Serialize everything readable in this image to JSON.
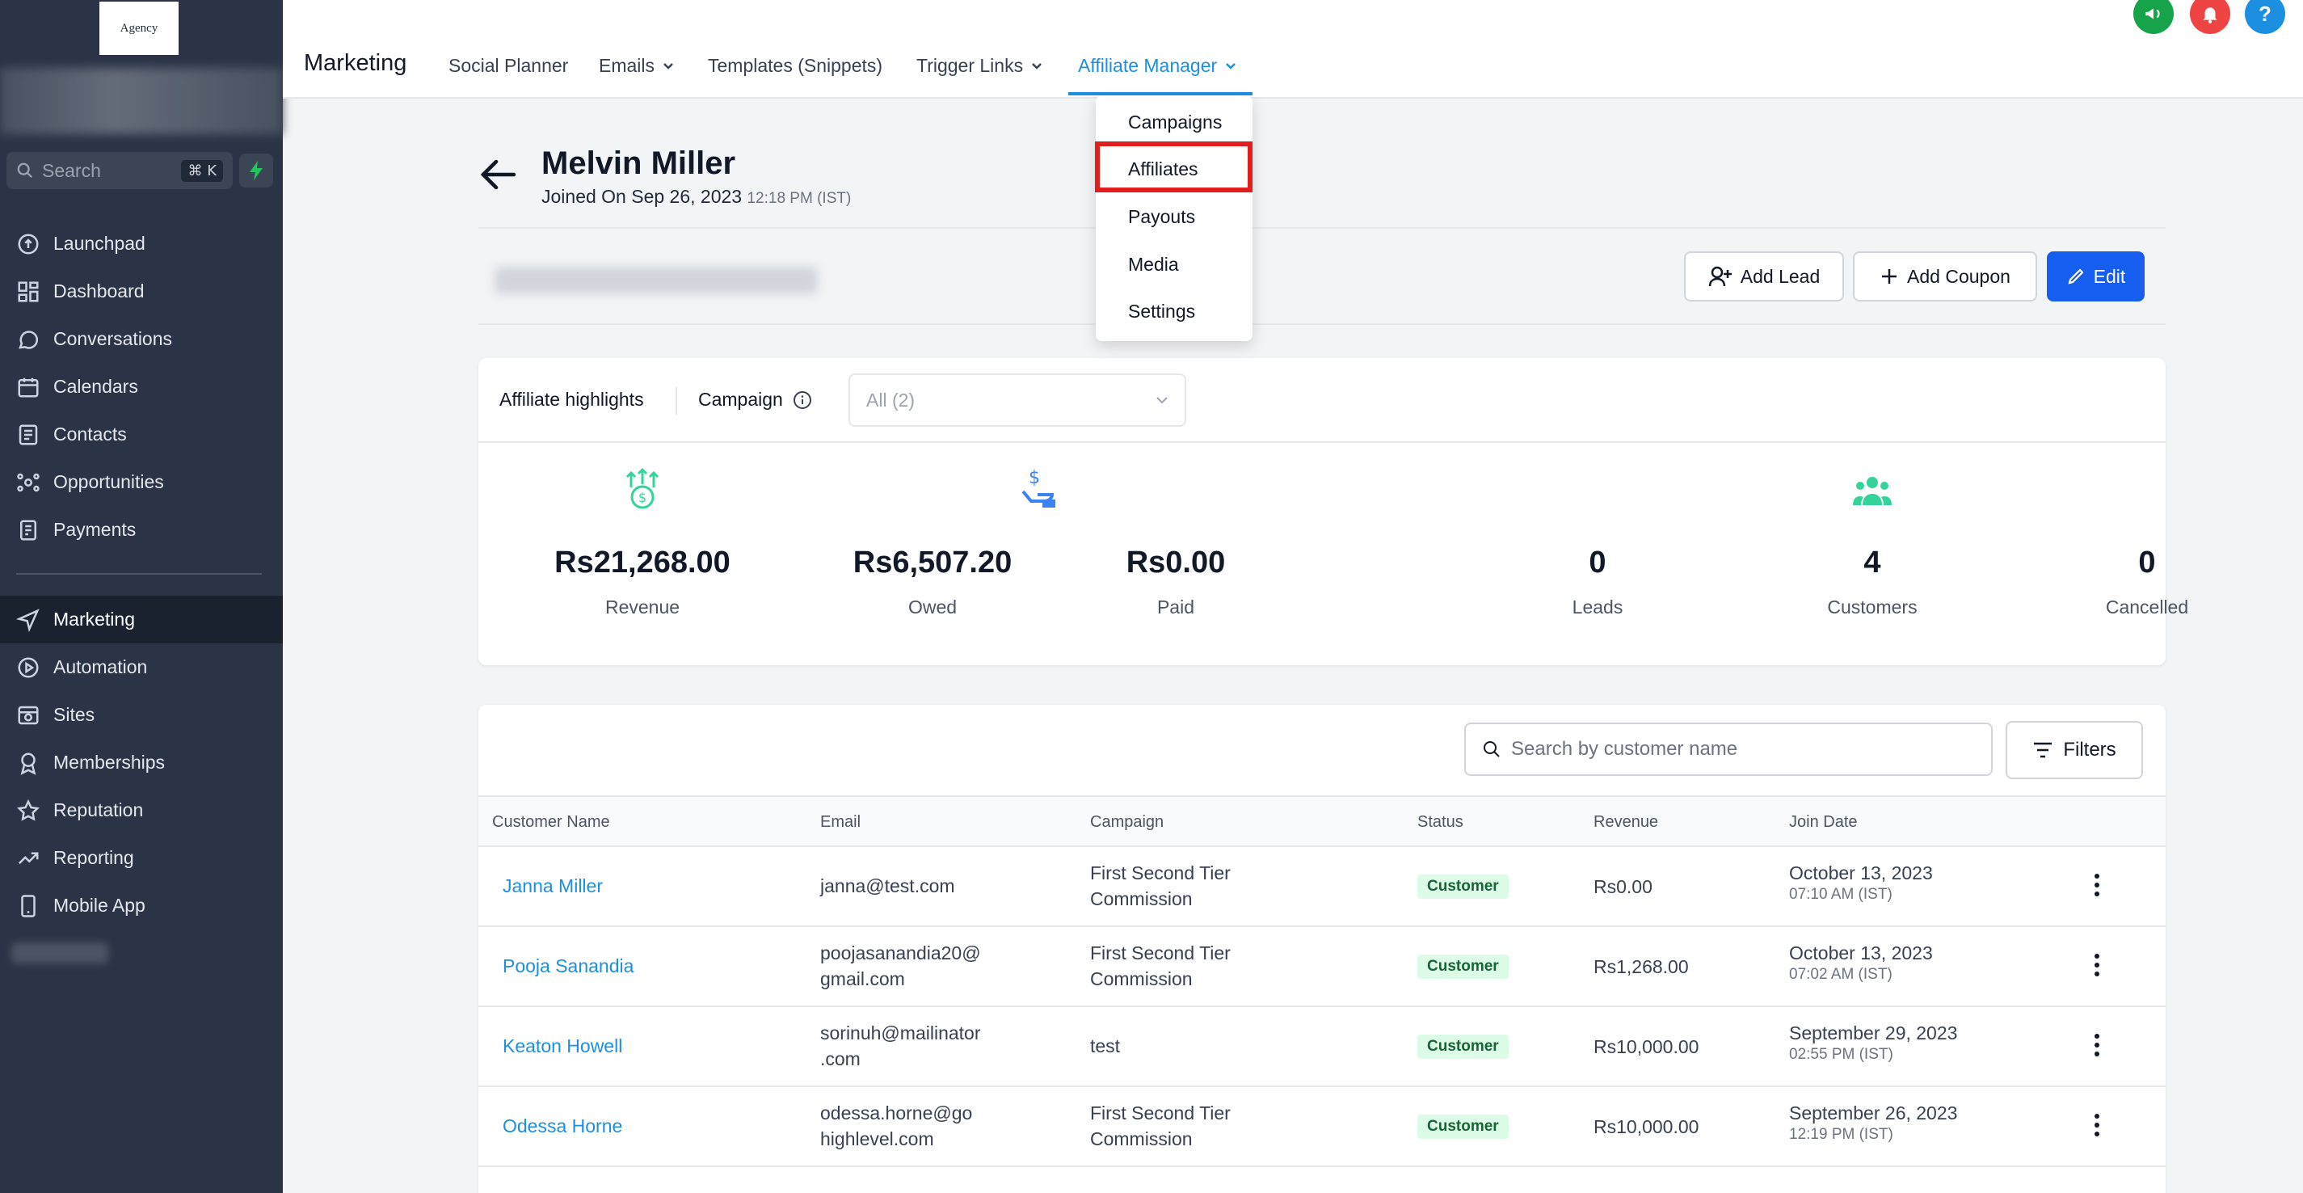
{
  "sidebar": {
    "logo_text": "Agency",
    "search_placeholder": "Search",
    "search_shortcut": "⌘ K",
    "items": [
      {
        "label": "Launchpad",
        "icon": "launchpad-icon"
      },
      {
        "label": "Dashboard",
        "icon": "dashboard-icon"
      },
      {
        "label": "Conversations",
        "icon": "chat-icon"
      },
      {
        "label": "Calendars",
        "icon": "calendar-icon"
      },
      {
        "label": "Contacts",
        "icon": "contacts-icon"
      },
      {
        "label": "Opportunities",
        "icon": "opportunities-icon"
      },
      {
        "label": "Payments",
        "icon": "payments-icon"
      },
      {
        "label": "Marketing",
        "icon": "send-icon"
      },
      {
        "label": "Automation",
        "icon": "automation-icon"
      },
      {
        "label": "Sites",
        "icon": "sites-icon"
      },
      {
        "label": "Memberships",
        "icon": "badge-icon"
      },
      {
        "label": "Reputation",
        "icon": "star-icon"
      },
      {
        "label": "Reporting",
        "icon": "trend-icon"
      },
      {
        "label": "Mobile App",
        "icon": "phone-icon"
      }
    ],
    "active_item": "Marketing"
  },
  "topbar": {
    "title": "Marketing",
    "tabs": [
      {
        "label": "Social Planner"
      },
      {
        "label": "Emails"
      },
      {
        "label": "Templates (Snippets)"
      },
      {
        "label": "Trigger Links"
      },
      {
        "label": "Affiliate Manager"
      }
    ],
    "active_tab": "Affiliate Manager",
    "icons": [
      {
        "name": "megaphone-icon",
        "color": "#16a34a"
      },
      {
        "name": "bell-icon",
        "color": "#ef4444"
      },
      {
        "name": "help-icon",
        "color": "#1d8fe0",
        "glyph": "?"
      }
    ]
  },
  "dropdown": {
    "items": [
      "Campaigns",
      "Affiliates",
      "Payouts",
      "Media",
      "Settings"
    ],
    "highlighted": "Affiliates"
  },
  "profile": {
    "name": "Melvin Miller",
    "joined_prefix": "Joined On Sep 26, 2023",
    "joined_time": "12:18 PM (IST)"
  },
  "actions": {
    "add_lead": "Add Lead",
    "add_coupon": "Add Coupon",
    "edit": "Edit"
  },
  "highlights": {
    "title": "Affiliate highlights",
    "campaign_label": "Campaign",
    "campaign_select": "All (2)",
    "stats": [
      {
        "value": "Rs21,268.00",
        "label": "Revenue",
        "icon": "money-growth-icon"
      },
      {
        "value": "Rs6,507.20",
        "label": "Owed",
        "icon": "hand-money-icon"
      },
      {
        "value": "Rs0.00",
        "label": "Paid",
        "icon": ""
      },
      {
        "value": "0",
        "label": "Leads",
        "icon": ""
      },
      {
        "value": "4",
        "label": "Customers",
        "icon": "users-group-icon"
      },
      {
        "value": "0",
        "label": "Cancelled",
        "icon": ""
      }
    ]
  },
  "table": {
    "search_placeholder": "Search by customer name",
    "filters_label": "Filters",
    "columns": [
      "Customer Name",
      "Email",
      "Campaign",
      "Status",
      "Revenue",
      "Join Date"
    ],
    "rows": [
      {
        "name": "Janna Miller",
        "email": [
          "janna@test.com"
        ],
        "campaign": [
          "First Second Tier",
          "Commission"
        ],
        "status": "Customer",
        "revenue": "Rs0.00",
        "date": "October 13, 2023",
        "time": "07:10 AM (IST)"
      },
      {
        "name": "Pooja Sanandia",
        "email": [
          "poojasanandia20@",
          "gmail.com"
        ],
        "campaign": [
          "First Second Tier",
          "Commission"
        ],
        "status": "Customer",
        "revenue": "Rs1,268.00",
        "date": "October 13, 2023",
        "time": "07:02 AM (IST)"
      },
      {
        "name": "Keaton Howell",
        "email": [
          "sorinuh@mailinator",
          ".com"
        ],
        "campaign": [
          "test"
        ],
        "status": "Customer",
        "revenue": "Rs10,000.00",
        "date": "September 29, 2023",
        "time": "02:55 PM (IST)"
      },
      {
        "name": "Odessa Horne",
        "email": [
          "odessa.horne@go",
          "highlevel.com"
        ],
        "campaign": [
          "First Second Tier",
          "Commission"
        ],
        "status": "Customer",
        "revenue": "Rs10,000.00",
        "date": "September 26, 2023",
        "time": "12:19 PM (IST)"
      }
    ]
  },
  "colors": {
    "sidebar_bg": "#2a3446",
    "accent_blue": "#1d8fe0",
    "primary_button": "#155eef",
    "highlight_red": "#e11d1d",
    "stat_icon_green": "#34d399",
    "stat_icon_blue": "#3b82f6"
  }
}
